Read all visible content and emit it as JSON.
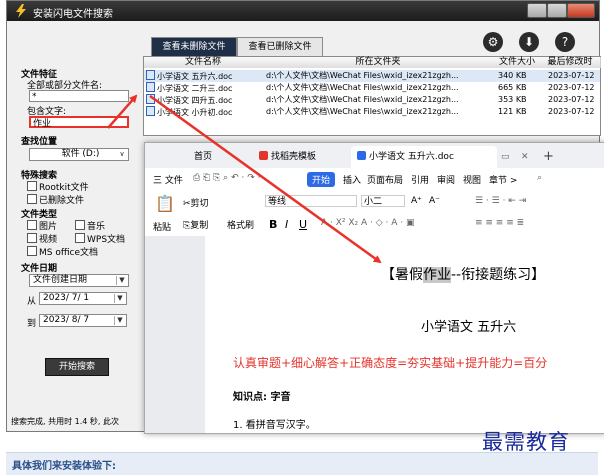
{
  "window": {
    "title": "安装闪电文件搜索"
  },
  "tabs": {
    "unread": "查看未删除文件",
    "deleted": "查看已删除文件"
  },
  "left": {
    "feature_title": "文件特征",
    "name_label": "全部或部分文件名:",
    "name_value": "*",
    "content_label": "包含文字:",
    "content_value": "作业",
    "location_title": "查找位置",
    "location_value": "软件 (D:)",
    "special_title": "特殊搜索",
    "rootkit": "Rootkit文件",
    "deleted": "已删除文件",
    "types_title": "文件类型",
    "type_image": "图片",
    "type_music": "音乐",
    "type_video": "视频",
    "type_wps": "WPS文档",
    "type_office": "MS office文档",
    "date_title": "文件日期",
    "date_mode": "文件创建日期",
    "from_label": "从",
    "from_value": "2023/ 7/ 1",
    "to_label": "到",
    "to_value": "2023/ 8/ 7",
    "start_button": "开始搜索"
  },
  "results": {
    "headers": [
      "文件名称",
      "所在文件夹",
      "文件大小",
      "最后修改时"
    ],
    "rows": [
      {
        "name": "小学语文 五升六.doc",
        "folder": "d:\\个人文件\\文档\\WeChat Files\\wxid_izex21zgzh...",
        "size": "340 KB",
        "date": "2023-07-12"
      },
      {
        "name": "小学语文 二升三.doc",
        "folder": "d:\\个人文件\\文档\\WeChat Files\\wxid_izex21zgzh...",
        "size": "665 KB",
        "date": "2023-07-12"
      },
      {
        "name": "小学语文 四升五.doc",
        "folder": "d:\\个人文件\\文档\\WeChat Files\\wxid_izex21zgzh...",
        "size": "353 KB",
        "date": "2023-07-12"
      },
      {
        "name": "小学语文 小升初.doc",
        "folder": "d:\\个人文件\\文档\\WeChat Files\\wxid_izex21zgzh...",
        "size": "121 KB",
        "date": "2023-07-12"
      }
    ]
  },
  "status": "搜索完成, 共用时 1.4 秒, 此次",
  "wps": {
    "tab_home": "首页",
    "tab_template": "找稻壳模板",
    "tab_doc": "小学语文 五升六.doc",
    "tab_add": "+",
    "menus": [
      "三 文件",
      "开始",
      "插入",
      "页面布局",
      "引用",
      "审阅",
      "视图",
      "章节 >"
    ],
    "ribbon": {
      "paste": "粘贴",
      "cut": "剪切",
      "copy": "复制",
      "format_painter": "格式刷",
      "font": "等线",
      "size": "小二",
      "bold": "B",
      "italic": "I",
      "underline": "U",
      "font_grow": "A⁺",
      "font_shrink": "A⁻"
    },
    "doc": {
      "heading_prefix": "【暑假",
      "heading_highlight": "作业",
      "heading_suffix": "--衔接题练习】",
      "subtitle": "小学语文  五升六",
      "motto": "认真审题+细心解答+正确态度=夯实基础+提升能力=百分",
      "knowledge": "知识点: 字音",
      "item1": "1.   看拼音写汉字。"
    }
  },
  "bottom": {
    "text": "具体我们来安装体验下:"
  },
  "watermark": "最需教育",
  "colors": {
    "arrow": "#e8322a",
    "accent": "#2d6be6",
    "motto": "#e4332b",
    "highlight": "#c9c9c9"
  }
}
